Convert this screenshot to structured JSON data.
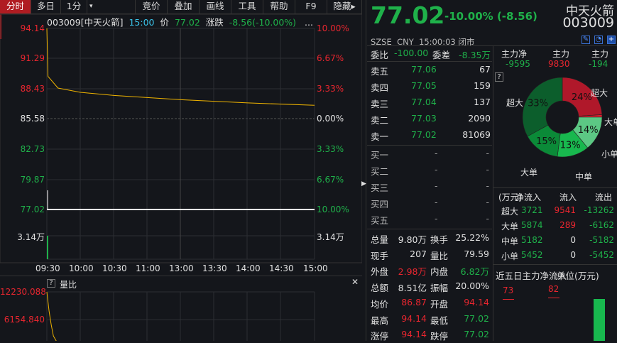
{
  "toolbar": {
    "tabs": [
      "分时",
      "多日",
      "1分",
      "▾"
    ],
    "right": [
      "竞价",
      "叠加",
      "画线",
      "工具",
      "帮助",
      "F9",
      "隐藏▸"
    ]
  },
  "chart_header": {
    "code": "003009[中天火箭]",
    "time": "15:00",
    "price_label": "价",
    "price": "77.02",
    "chg_label": "涨跌",
    "chg": "-8.56(-10.00%)",
    "more": "..."
  },
  "left_axis": [
    "94.14",
    "91.29",
    "88.43",
    "85.58",
    "82.73",
    "79.87",
    "77.02",
    "3.14万"
  ],
  "right_axis": [
    "10.00%",
    "6.67%",
    "3.33%",
    "0.00%",
    "3.33%",
    "6.67%",
    "10.00%",
    "3.14万"
  ],
  "time_axis": [
    "09:30",
    "10:00",
    "10:30",
    "11:00",
    "13:00",
    "13:30",
    "14:00",
    "14:30",
    "15:00"
  ],
  "sub_chart": {
    "help": "?",
    "title": "量比",
    "axis": [
      "12230.088",
      "6154.840"
    ],
    "close": "✕"
  },
  "chart_data": [
    {
      "type": "line",
      "title": "分时",
      "ylim": [
        77.02,
        94.14
      ],
      "series": [
        {
          "name": "价格",
          "color": "#ffffff",
          "x": [
            "09:30",
            "15:00"
          ],
          "values": [
            77.02,
            77.02
          ]
        },
        {
          "name": "均价",
          "color": "#f0b400",
          "x": [
            "09:30",
            "09:31",
            "09:40",
            "10:00",
            "10:30",
            "11:00",
            "13:00",
            "14:00",
            "15:00"
          ],
          "values": [
            94.14,
            89.6,
            88.5,
            88.1,
            87.8,
            87.6,
            87.4,
            87.1,
            86.87
          ]
        }
      ]
    },
    {
      "type": "line",
      "title": "量比",
      "ylim": [
        0,
        12230.088
      ],
      "series": [
        {
          "name": "量比",
          "color": "#f0b400",
          "x": [
            "09:30",
            "09:31",
            "09:32",
            "09:33",
            "09:35"
          ],
          "values": [
            12230.088,
            8000,
            5000,
            2500,
            1200
          ]
        }
      ]
    }
  ],
  "quote": {
    "price": "77.02",
    "pct": "-10.00%",
    "chg": "(-8.56)",
    "name": "中天火箭",
    "code": "003009",
    "exchange": "SZSE",
    "currency": "CNY",
    "time": "15:00:03",
    "status": "闭市"
  },
  "weibi": {
    "label": "委比",
    "value": "-100.00",
    "diff_label": "委差",
    "diff": "-8.35万"
  },
  "asks": [
    {
      "l": "卖五",
      "p": "77.06",
      "v": "67"
    },
    {
      "l": "卖四",
      "p": "77.05",
      "v": "159"
    },
    {
      "l": "卖三",
      "p": "77.04",
      "v": "137"
    },
    {
      "l": "卖二",
      "p": "77.03",
      "v": "2090"
    },
    {
      "l": "卖一",
      "p": "77.02",
      "v": "81069"
    }
  ],
  "bids": [
    {
      "l": "买一",
      "p": "-",
      "v": "-"
    },
    {
      "l": "买二",
      "p": "-",
      "v": "-"
    },
    {
      "l": "买三",
      "p": "-",
      "v": "-"
    },
    {
      "l": "买四",
      "p": "-",
      "v": "-"
    },
    {
      "l": "买五",
      "p": "-",
      "v": "-"
    }
  ],
  "stats": [
    {
      "l1": "总量",
      "v1": "9.80万",
      "c1": "w",
      "l2": "换手",
      "v2": "25.22%",
      "c2": "w"
    },
    {
      "l1": "现手",
      "v1": "207",
      "c1": "w",
      "l2": "量比",
      "v2": "79.59",
      "c2": "w"
    },
    {
      "l1": "外盘",
      "v1": "2.98万",
      "c1": "r",
      "l2": "内盘",
      "v2": "6.82万",
      "c2": "g"
    },
    {
      "l1": "总额",
      "v1": "8.51亿",
      "c1": "w",
      "l2": "振幅",
      "v2": "20.00%",
      "c2": "w"
    },
    {
      "l1": "均价",
      "v1": "86.87",
      "c1": "r",
      "l2": "开盘",
      "v2": "94.14",
      "c2": "r"
    },
    {
      "l1": "最高",
      "v1": "94.14",
      "c1": "r",
      "l2": "最低",
      "v2": "77.02",
      "c2": "g"
    },
    {
      "l1": "涨停",
      "v1": "94.14",
      "c1": "r",
      "l2": "跌停",
      "v2": "77.02",
      "c2": "g"
    }
  ],
  "main_force": {
    "h1": "主力净",
    "h2": "主力",
    "h3": "主力",
    "v1": "-9595",
    "v2": "9830",
    "v3": "-194",
    "help": "?"
  },
  "pie": {
    "slices": [
      {
        "label": "超大",
        "pct": 24,
        "text": "24%",
        "color": "#b0182a"
      },
      {
        "label": "大单",
        "pct": 1,
        "text": "",
        "color": "#d8202e"
      },
      {
        "label": "小单",
        "pct": 14,
        "text": "14%",
        "color": "#5cc884"
      },
      {
        "label": "中单",
        "pct": 13,
        "text": "13%",
        "color": "#18b84e"
      },
      {
        "label": "大单",
        "pct": 15,
        "text": "15%",
        "color": "#0b8a38"
      },
      {
        "label": "超大",
        "pct": 33,
        "text": "33%",
        "color": "#0c5e2c"
      }
    ],
    "labels": {
      "in_super": "超大",
      "in_big": "大单",
      "out_small": "小单",
      "out_mid": "中单",
      "out_big": "大单",
      "out_super": "超大"
    }
  },
  "flow": {
    "headers": [
      "(万元)",
      "净流入",
      "流入",
      "流出"
    ],
    "rows": [
      {
        "l": "超大",
        "net": "3721",
        "in": "9541",
        "out": "-13262"
      },
      {
        "l": "大单",
        "net": "5874",
        "in": "289",
        "out": "-6162"
      },
      {
        "l": "中单",
        "net": "5182",
        "in": "0",
        "out": "-5182"
      },
      {
        "l": "小单",
        "net": "5452",
        "in": "0",
        "out": "-5452"
      }
    ]
  },
  "five_day": {
    "title": "近五日主力净流入",
    "unit": "单位(万元)",
    "values": [
      "73",
      "82"
    ]
  }
}
